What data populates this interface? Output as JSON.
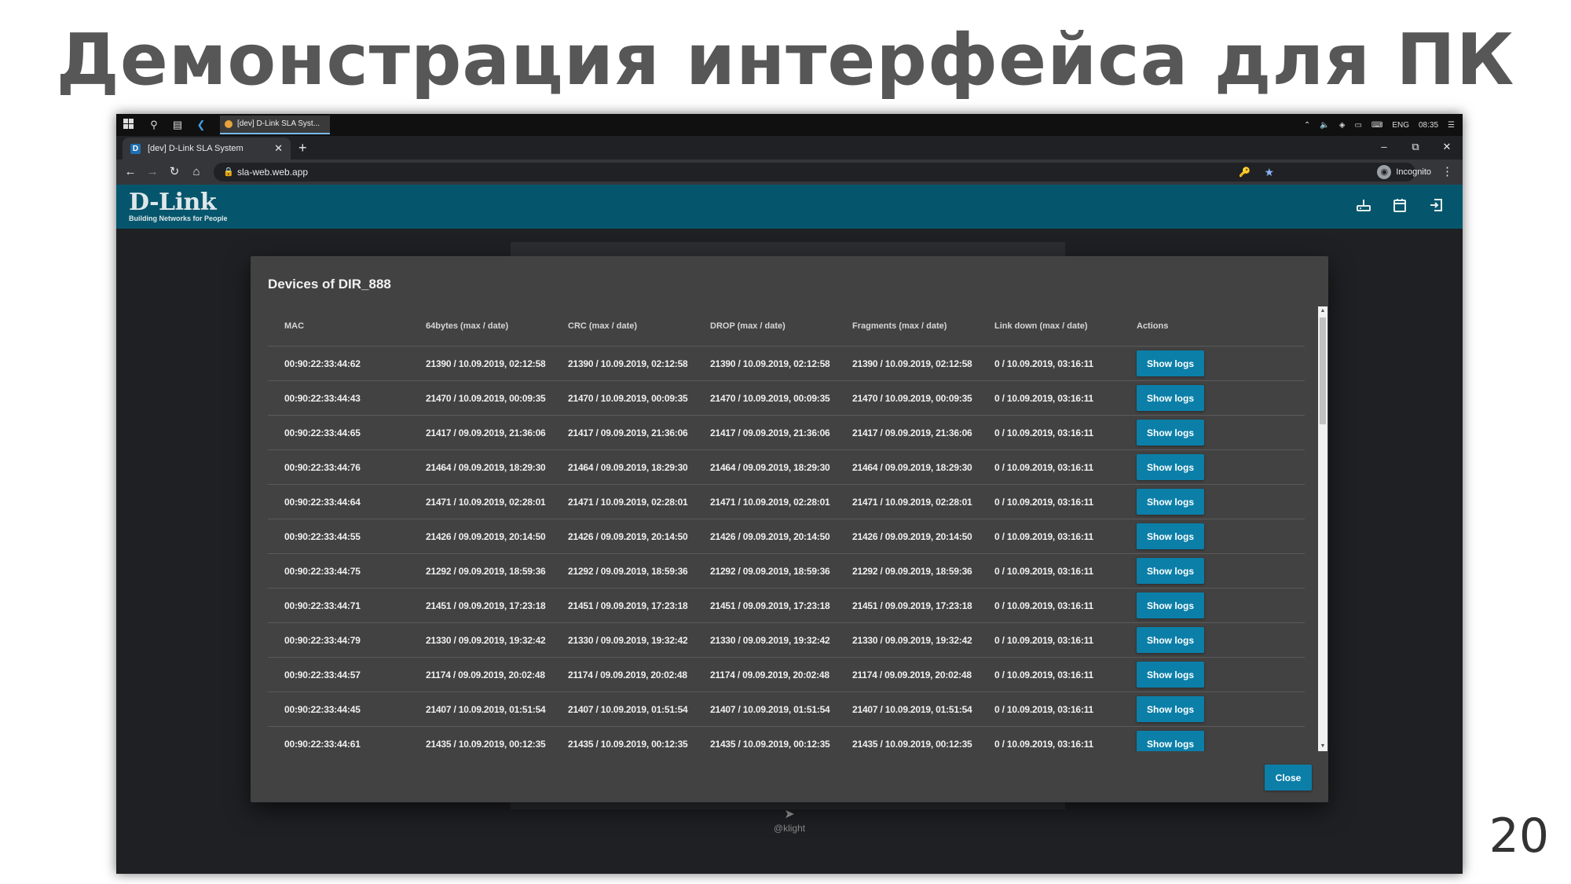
{
  "slide": {
    "title": "Демонстрация интерфейса для ПК",
    "page_number": "20"
  },
  "taskbar": {
    "app_label": "[dev] D-Link SLA Syst...",
    "language": "ENG",
    "time": "08:35"
  },
  "browser": {
    "tab_title": "[dev] D-Link SLA System",
    "url": "sla-web.web.app",
    "profile_label": "Incognito"
  },
  "app": {
    "logo_text": "D-Link",
    "logo_tagline": "Building Networks for People",
    "footer_text": "@klight"
  },
  "modal": {
    "title": "Devices of DIR_888",
    "columns": [
      "MAC",
      "64bytes (max / date)",
      "CRC (max / date)",
      "DROP (max / date)",
      "Fragments (max / date)",
      "Link down (max / date)",
      "Actions"
    ],
    "action_label": "Show logs",
    "close_label": "Close",
    "rows": [
      {
        "mac": "00:90:22:33:44:62",
        "bytes64": "21390 / 10.09.2019, 02:12:58",
        "crc": "21390 / 10.09.2019, 02:12:58",
        "drop": "21390 / 10.09.2019, 02:12:58",
        "fragments": "21390 / 10.09.2019, 02:12:58",
        "link_down": "0 / 10.09.2019, 03:16:11"
      },
      {
        "mac": "00:90:22:33:44:43",
        "bytes64": "21470 / 10.09.2019, 00:09:35",
        "crc": "21470 / 10.09.2019, 00:09:35",
        "drop": "21470 / 10.09.2019, 00:09:35",
        "fragments": "21470 / 10.09.2019, 00:09:35",
        "link_down": "0 / 10.09.2019, 03:16:11"
      },
      {
        "mac": "00:90:22:33:44:65",
        "bytes64": "21417 / 09.09.2019, 21:36:06",
        "crc": "21417 / 09.09.2019, 21:36:06",
        "drop": "21417 / 09.09.2019, 21:36:06",
        "fragments": "21417 / 09.09.2019, 21:36:06",
        "link_down": "0 / 10.09.2019, 03:16:11"
      },
      {
        "mac": "00:90:22:33:44:76",
        "bytes64": "21464 / 09.09.2019, 18:29:30",
        "crc": "21464 / 09.09.2019, 18:29:30",
        "drop": "21464 / 09.09.2019, 18:29:30",
        "fragments": "21464 / 09.09.2019, 18:29:30",
        "link_down": "0 / 10.09.2019, 03:16:11"
      },
      {
        "mac": "00:90:22:33:44:64",
        "bytes64": "21471 / 10.09.2019, 02:28:01",
        "crc": "21471 / 10.09.2019, 02:28:01",
        "drop": "21471 / 10.09.2019, 02:28:01",
        "fragments": "21471 / 10.09.2019, 02:28:01",
        "link_down": "0 / 10.09.2019, 03:16:11"
      },
      {
        "mac": "00:90:22:33:44:55",
        "bytes64": "21426 / 09.09.2019, 20:14:50",
        "crc": "21426 / 09.09.2019, 20:14:50",
        "drop": "21426 / 09.09.2019, 20:14:50",
        "fragments": "21426 / 09.09.2019, 20:14:50",
        "link_down": "0 / 10.09.2019, 03:16:11"
      },
      {
        "mac": "00:90:22:33:44:75",
        "bytes64": "21292 / 09.09.2019, 18:59:36",
        "crc": "21292 / 09.09.2019, 18:59:36",
        "drop": "21292 / 09.09.2019, 18:59:36",
        "fragments": "21292 / 09.09.2019, 18:59:36",
        "link_down": "0 / 10.09.2019, 03:16:11"
      },
      {
        "mac": "00:90:22:33:44:71",
        "bytes64": "21451 / 09.09.2019, 17:23:18",
        "crc": "21451 / 09.09.2019, 17:23:18",
        "drop": "21451 / 09.09.2019, 17:23:18",
        "fragments": "21451 / 09.09.2019, 17:23:18",
        "link_down": "0 / 10.09.2019, 03:16:11"
      },
      {
        "mac": "00:90:22:33:44:79",
        "bytes64": "21330 / 09.09.2019, 19:32:42",
        "crc": "21330 / 09.09.2019, 19:32:42",
        "drop": "21330 / 09.09.2019, 19:32:42",
        "fragments": "21330 / 09.09.2019, 19:32:42",
        "link_down": "0 / 10.09.2019, 03:16:11"
      },
      {
        "mac": "00:90:22:33:44:57",
        "bytes64": "21174 / 09.09.2019, 20:02:48",
        "crc": "21174 / 09.09.2019, 20:02:48",
        "drop": "21174 / 09.09.2019, 20:02:48",
        "fragments": "21174 / 09.09.2019, 20:02:48",
        "link_down": "0 / 10.09.2019, 03:16:11"
      },
      {
        "mac": "00:90:22:33:44:45",
        "bytes64": "21407 / 10.09.2019, 01:51:54",
        "crc": "21407 / 10.09.2019, 01:51:54",
        "drop": "21407 / 10.09.2019, 01:51:54",
        "fragments": "21407 / 10.09.2019, 01:51:54",
        "link_down": "0 / 10.09.2019, 03:16:11"
      },
      {
        "mac": "00:90:22:33:44:61",
        "bytes64": "21435 / 10.09.2019, 00:12:35",
        "crc": "21435 / 10.09.2019, 00:12:35",
        "drop": "21435 / 10.09.2019, 00:12:35",
        "fragments": "21435 / 10.09.2019, 00:12:35",
        "link_down": "0 / 10.09.2019, 03:16:11"
      }
    ]
  },
  "colors": {
    "appbar": "#05566c",
    "button": "#0b7fa8",
    "modal_bg": "#424242",
    "page_bg": "#1f2023"
  },
  "icons": {
    "taskbar": [
      "windows-start-icon",
      "search-icon",
      "task-view-icon",
      "vscode-icon"
    ],
    "appbar": [
      "router-icon",
      "calendar-icon",
      "logout-icon"
    ]
  }
}
